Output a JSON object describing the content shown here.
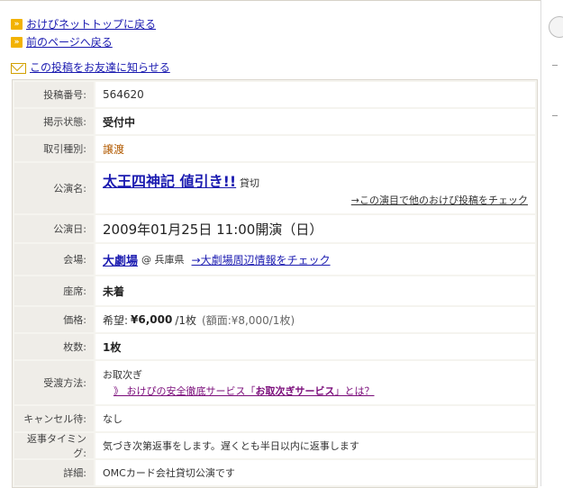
{
  "nav": {
    "top_link": "おけぴネットトップに戻る",
    "back_link": "前のページへ戻る",
    "share_link": "この投稿をお友達に知らせる",
    "bullet_glyph": "»"
  },
  "rows": {
    "post_no": {
      "label": "投稿番号:",
      "value": "564620"
    },
    "status": {
      "label": "掲示状態:",
      "value": "受付中"
    },
    "trade_type": {
      "label": "取引種別:",
      "value": "譲渡"
    },
    "show": {
      "label": "公演名:",
      "title": "太王四神記 値引き!!",
      "note": "貸切",
      "check_link": "→この演目で他のおけぴ投稿をチェック"
    },
    "date": {
      "label": "公演日:",
      "value": "2009年01月25日 11:00開演（日）"
    },
    "venue": {
      "label": "会場:",
      "name": "大劇場",
      "region": "@ 兵庫県",
      "info_link": "→大劇場周辺情報をチェック"
    },
    "seat": {
      "label": "座席:",
      "value": "未着"
    },
    "price": {
      "label": "価格:",
      "prefix": "希望:",
      "amount": "¥6,000",
      "unit": "/1枚",
      "face": "(額面:¥8,000/1枚)"
    },
    "count": {
      "label": "枚数:",
      "value": "1枚"
    },
    "delivery": {
      "label": "受渡方法:",
      "value": "お取次ぎ",
      "service_prefix": "》 おけぴの安全徹底サービス「",
      "service_name": "お取次ぎサービス",
      "service_suffix": "」とは？"
    },
    "cancel": {
      "label": "キャンセル待:",
      "value": "なし"
    },
    "reply": {
      "label": "返事タイミング:",
      "value": "気づき次第返事をします。遅くとも半日以内に返事します"
    },
    "detail": {
      "label": "詳細:",
      "value": "OMCカード会社貸切公演です"
    }
  }
}
